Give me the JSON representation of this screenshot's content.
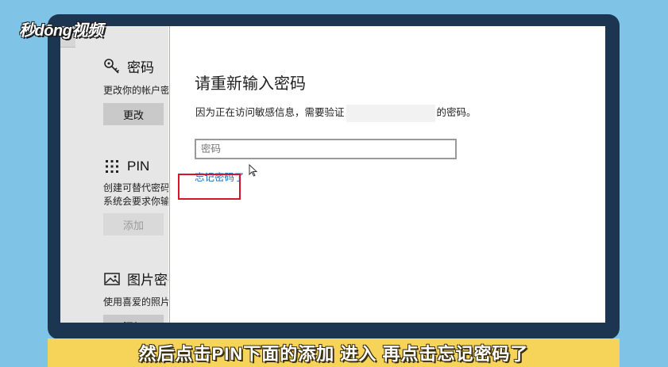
{
  "logo": {
    "text": "秒dōng视频"
  },
  "sidebar": {
    "password": {
      "title": "密码",
      "desc": "更改你的帐户密",
      "button": "更改",
      "icon": "key-icon"
    },
    "pin": {
      "title": "PIN",
      "desc_line1": "创建可替代密码",
      "desc_line2": "系统会要求你输",
      "button": "添加",
      "icon": "keypad-icon"
    },
    "picture": {
      "title": "图片密码",
      "desc": "使用喜爱的照片",
      "button": "添加",
      "icon": "picture-icon"
    }
  },
  "dialog": {
    "title": "请重新输入密码",
    "desc_before": "因为正在访问敏感信息，需要验证",
    "desc_after": "的密码。",
    "input_placeholder": "密码",
    "forgot_link": "忘记密码了"
  },
  "subtitle": "然后点击PIN下面的添加 进入 再点击忘记密码了",
  "colors": {
    "accent_link": "#1f6fb5",
    "highlight": "#d9132a",
    "subtitle_bar": "#f6d45a",
    "background": "#7fc3e6"
  }
}
